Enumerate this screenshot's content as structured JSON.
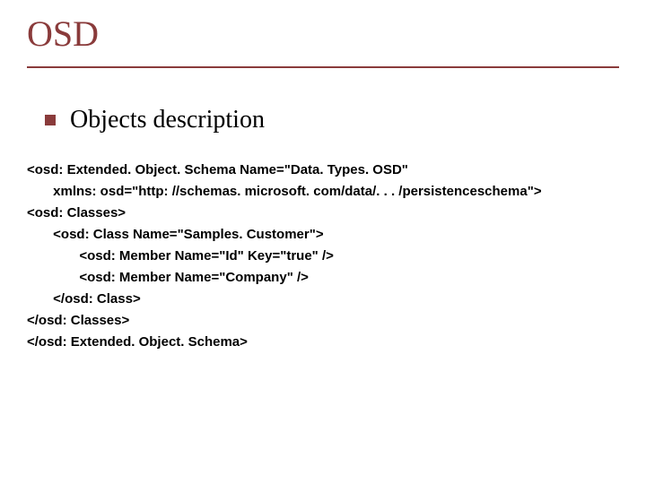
{
  "title": "OSD",
  "subtitle": "Objects description",
  "code": {
    "l1": "<osd: Extended. Object. Schema Name=\"Data. Types. OSD\"",
    "l2": "       xmlns: osd=\"http: //schemas. microsoft. com/data/. . . /persistenceschema\">",
    "l3": "<osd: Classes>",
    "l4": "       <osd: Class Name=\"Samples. Customer\">",
    "l5": "              <osd: Member Name=\"Id\" Key=\"true\" />",
    "l6": "              <osd: Member Name=\"Company\" />",
    "l7": "       </osd: Class>",
    "l8": "</osd: Classes>",
    "l9": "</osd: Extended. Object. Schema>"
  }
}
